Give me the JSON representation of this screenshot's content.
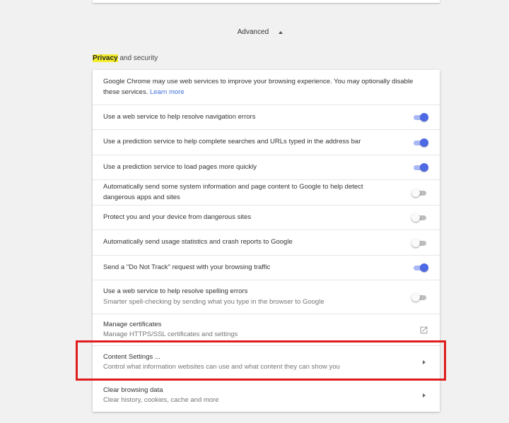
{
  "advanced": {
    "label": "Advanced",
    "icon": "caret-up-icon"
  },
  "section": {
    "title_highlight": "Privacy",
    "title_rest": " and security"
  },
  "intro": {
    "text": "Google Chrome may use web services to improve your browsing experience. You may optionally disable these services.",
    "link": "Learn more"
  },
  "rows": [
    {
      "label": "Use a web service to help resolve navigation errors",
      "state": "on"
    },
    {
      "label": "Use a prediction service to help complete searches and URLs typed in the address bar",
      "state": "on"
    },
    {
      "label": "Use a prediction service to load pages more quickly",
      "state": "on"
    },
    {
      "label": "Automatically send some system information and page content to Google to help detect dangerous apps and sites",
      "state": "off"
    },
    {
      "label": "Protect you and your device from dangerous sites",
      "state": "off"
    },
    {
      "label": "Automatically send usage statistics and crash reports to Google",
      "state": "off"
    },
    {
      "label": "Send a \"Do Not Track\" request with your browsing traffic",
      "state": "on"
    },
    {
      "label": "Use a web service to help resolve spelling errors",
      "sub": "Smarter spell-checking by sending what you type in the browser to Google",
      "state": "off"
    }
  ],
  "manage_certificates": {
    "label": "Manage certificates",
    "sub": "Manage HTTPS/SSL certificates and settings",
    "icon": "external-link-icon"
  },
  "content_settings": {
    "label": "Content Settings ...",
    "sub": "Control what information websites can use and what content they can show you",
    "icon": "chevron-right-icon"
  },
  "clear_browsing": {
    "label": "Clear browsing data",
    "sub": "Clear history, cookies, cache and more",
    "icon": "chevron-right-icon"
  },
  "colors": {
    "toggle_on": "#4e69e4",
    "highlight": "#f5ef2e",
    "annotation_box": "#e01b1b",
    "link": "#3b6fd6"
  }
}
